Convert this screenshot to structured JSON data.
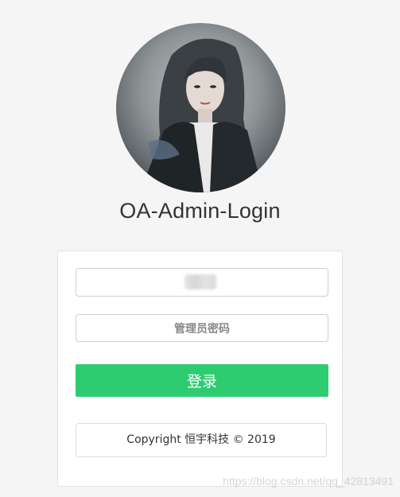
{
  "avatar": {
    "icon": "user-avatar-photo"
  },
  "page": {
    "title": "OA-Admin-Login"
  },
  "form": {
    "username": {
      "value": ""
    },
    "password": {
      "placeholder": "管理员密码",
      "value": ""
    },
    "login_label": "登录"
  },
  "footer": {
    "copyright": "Copyright 恒宇科技 © 2019"
  },
  "watermark": {
    "text": "https://blog.csdn.net/qq_42813491"
  },
  "colors": {
    "accent": "#2ecc71",
    "background": "#f5f5f5",
    "text": "#333333"
  }
}
